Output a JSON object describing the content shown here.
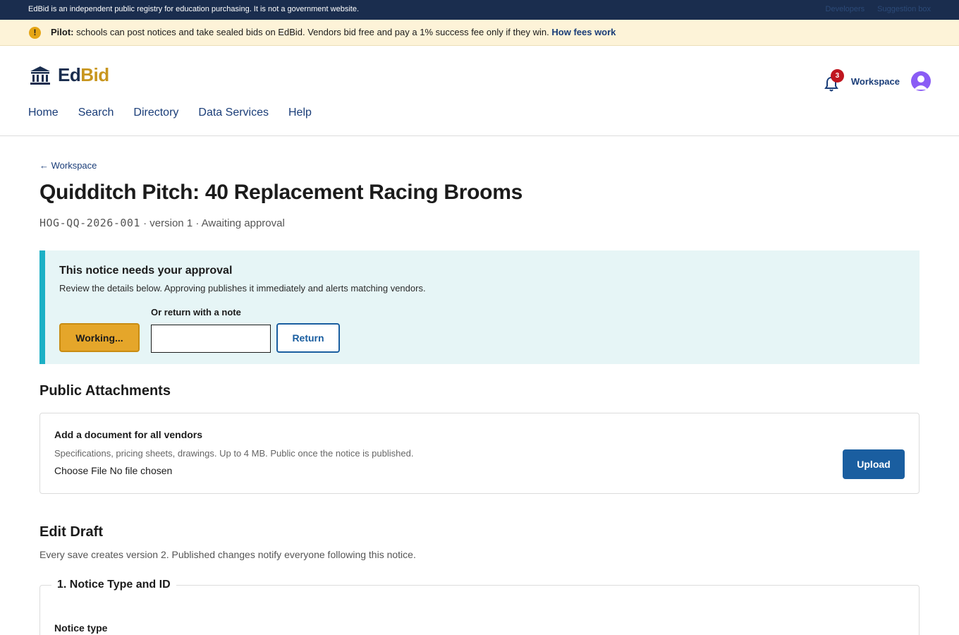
{
  "topbar": {
    "message": "EdBid is an independent public registry for education purchasing. It is not a government website.",
    "links": [
      "Developers",
      "Suggestion box"
    ]
  },
  "pilot": {
    "label": "Pilot:",
    "text": "schools can post notices and take sealed bids on EdBid. Vendors bid free and pay a 1% success fee only if they win.",
    "link": "How fees work"
  },
  "header": {
    "logo_ed": "Ed",
    "logo_bid": "Bid",
    "notifications_count": "3",
    "workspace_link": "Workspace",
    "nav": [
      "Home",
      "Search",
      "Directory",
      "Data Services",
      "Help"
    ]
  },
  "page": {
    "back_link": "← Workspace",
    "title": "Quidditch Pitch: 40 Replacement Racing Brooms",
    "notice_id": "HOG-QQ-2026-001",
    "meta_rest": " · version 1 · Awaiting approval"
  },
  "approval": {
    "heading": "This notice needs your approval",
    "description": "Review the details below. Approving publishes it immediately and alerts matching vendors.",
    "working_label": "Working...",
    "note_label": "Or return with a note",
    "note_value": "",
    "return_label": "Return"
  },
  "attachments": {
    "heading": "Public Attachments",
    "add_heading": "Add a document for all vendors",
    "hint": "Specifications, pricing sheets, drawings. Up to 4 MB. Public once the notice is published.",
    "file_state": "Choose File No file chosen",
    "upload_label": "Upload"
  },
  "edit": {
    "heading": "Edit Draft",
    "description": "Every save creates version 2. Published changes notify everyone following this notice.",
    "section1_legend": "1. Notice Type and ID",
    "notice_type_label": "Notice type"
  },
  "colors": {
    "navy": "#1a2d4e",
    "gold": "#c8961f",
    "link": "#1a3d78",
    "primary": "#1a5ea0",
    "teal_accent": "#1cb0c5"
  }
}
